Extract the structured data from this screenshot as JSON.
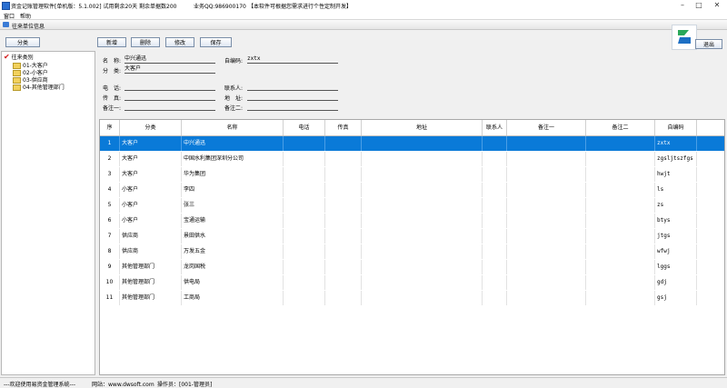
{
  "window": {
    "title": "资金记账管理软件[单机版：5.1.002]  试用剩余20天  剩余单据数200",
    "qq": "业务QQ:986900170",
    "notice": "【本软件可根据您需求进行个性定制开发】"
  },
  "menu": {
    "items": [
      "窗口",
      "帮助"
    ]
  },
  "panel": {
    "title": "往来单位信息"
  },
  "toolbar": {
    "category_label": "分类",
    "add_label": "新增",
    "delete_label": "删除",
    "edit_label": "修改",
    "save_label": "保存",
    "exit_label": "退出"
  },
  "tree": {
    "root": "往来类别",
    "items": [
      "01-大客户",
      "02-小客户",
      "03-供应商",
      "04-其他管理部门"
    ]
  },
  "form": {
    "name_label": "名　称:",
    "name_value": "中兴通迅",
    "code_label": "自编码:",
    "code_value": "zxtx",
    "category_label": "分　类:",
    "category_value": "大客户",
    "phone_label": "电　话:",
    "contact_label": "联系人:",
    "fax_label": "传　真:",
    "address_label": "地　址:",
    "note1_label": "备注一:",
    "note2_label": "备注二:"
  },
  "grid": {
    "columns": [
      "序",
      "分类",
      "名称",
      "电话",
      "传真",
      "地址",
      "联系人",
      "备注一",
      "备注二",
      "自编码"
    ],
    "rows": [
      {
        "no": "1",
        "category": "大客户",
        "name": "中兴通迅",
        "code": "zxtx"
      },
      {
        "no": "2",
        "category": "大客户",
        "name": "中国水利集团深圳分公司",
        "code": "zgsljtszfgs"
      },
      {
        "no": "3",
        "category": "大客户",
        "name": "华为集团",
        "code": "hwjt"
      },
      {
        "no": "4",
        "category": "小客户",
        "name": "李四",
        "code": "ls"
      },
      {
        "no": "5",
        "category": "小客户",
        "name": "张三",
        "code": "zs"
      },
      {
        "no": "6",
        "category": "小客户",
        "name": "宝通运输",
        "code": "btys"
      },
      {
        "no": "7",
        "category": "供应商",
        "name": "景田供水",
        "code": "jtgs"
      },
      {
        "no": "8",
        "category": "供应商",
        "name": "万发五金",
        "code": "wfwj"
      },
      {
        "no": "9",
        "category": "其他管理部门",
        "name": "龙岗国税",
        "code": "lggs"
      },
      {
        "no": "10",
        "category": "其他管理部门",
        "name": "供电局",
        "code": "gdj"
      },
      {
        "no": "11",
        "category": "其他管理部门",
        "name": "工商局",
        "code": "gsj"
      }
    ],
    "selected_row": 0
  },
  "status": {
    "welcome": "---欢迎使用易资金管理系统---",
    "website": "网站：www.dwsoft.com",
    "operator": "操作员：[001-管理员]"
  },
  "colors": {
    "selection": "#0a7ad8",
    "logo_green": "#2aa85a",
    "logo_blue": "#1d6fc4"
  },
  "icons": [
    "app-icon",
    "folder-icon",
    "check-icon",
    "logo-icon"
  ]
}
